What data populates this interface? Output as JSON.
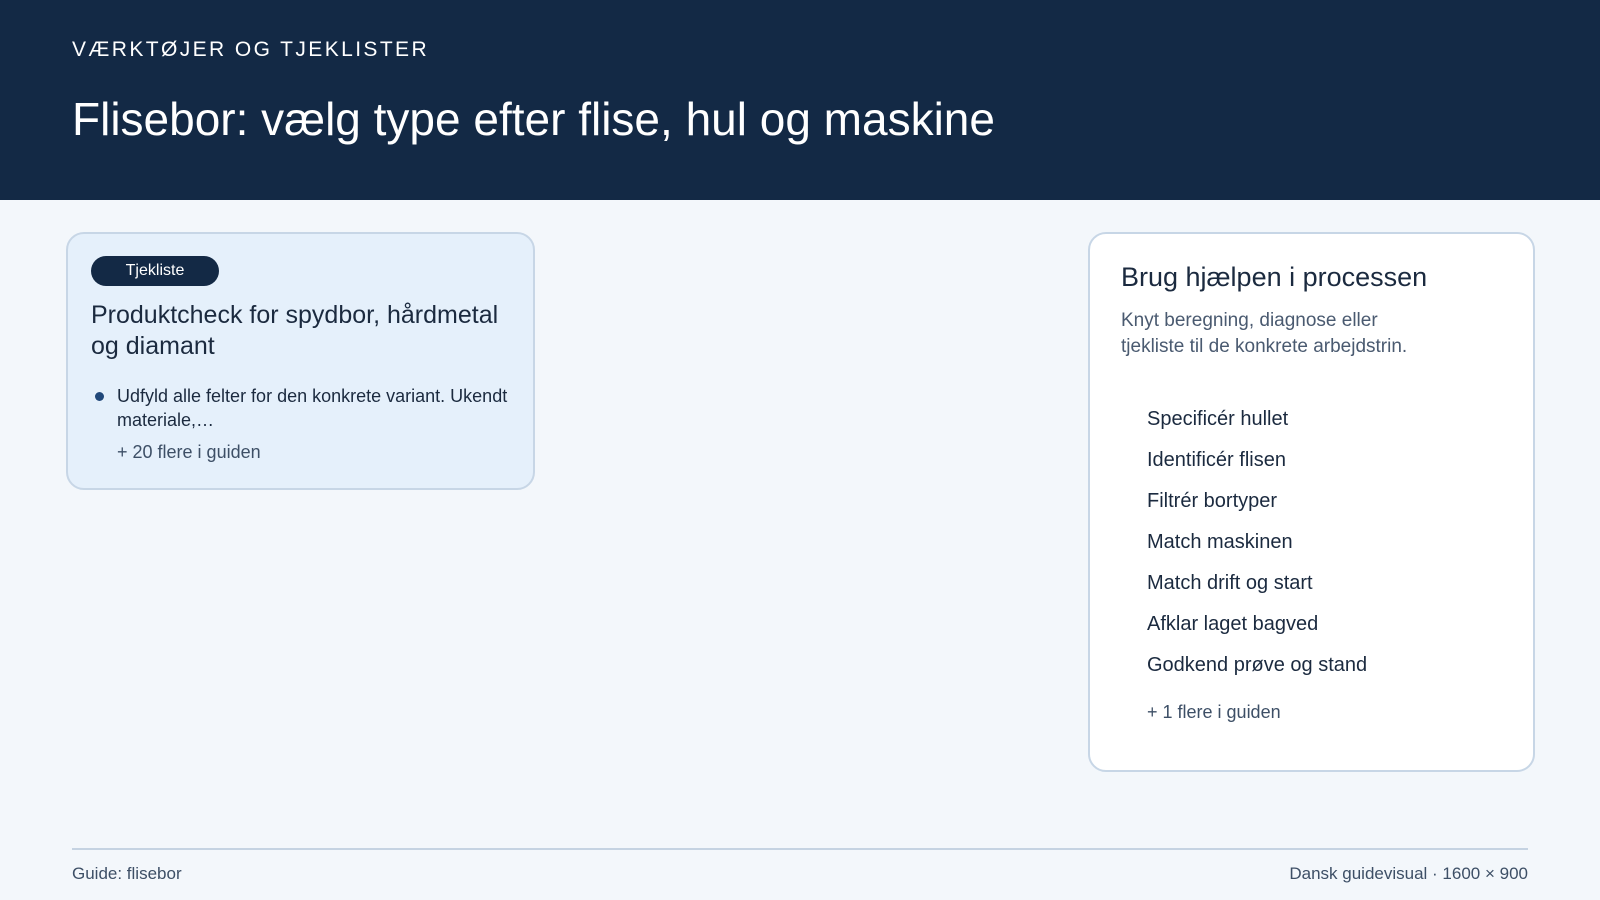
{
  "header": {
    "eyebrow": "VÆRKTØJER OG TJEKLISTER",
    "title": "Flisebor: vælg type efter flise, hul og maskine"
  },
  "checklist_card": {
    "badge": "Tjekliste",
    "title": "Produktcheck for spydbor, hårdmetal og diamant",
    "bullets": [
      "Udfyld alle felter for den konkrete variant. Ukendt materiale,…"
    ],
    "more": "+ 20 flere i guiden"
  },
  "process_card": {
    "title": "Brug hjælpen i processen",
    "description": "Knyt beregning, diagnose eller tjekliste til de konkrete arbejdstrin.",
    "steps": [
      "Specificér hullet",
      "Identificér flisen",
      "Filtrér bortyper",
      "Match maskinen",
      "Match drift og start",
      "Afklar laget bagved",
      "Godkend prøve og stand"
    ],
    "more": "+ 1 flere i guiden"
  },
  "footer": {
    "left": "Guide: flisebor",
    "right": "Dansk guidevisual · 1600 × 900"
  },
  "colors": {
    "header_bg": "#132945",
    "page_bg": "#f3f7fb",
    "checklist_card_bg": "#e5f0fb",
    "checklist_bullet": "#21487a",
    "process_bullet": "#17705f",
    "card_border": "#c7d6e6"
  }
}
